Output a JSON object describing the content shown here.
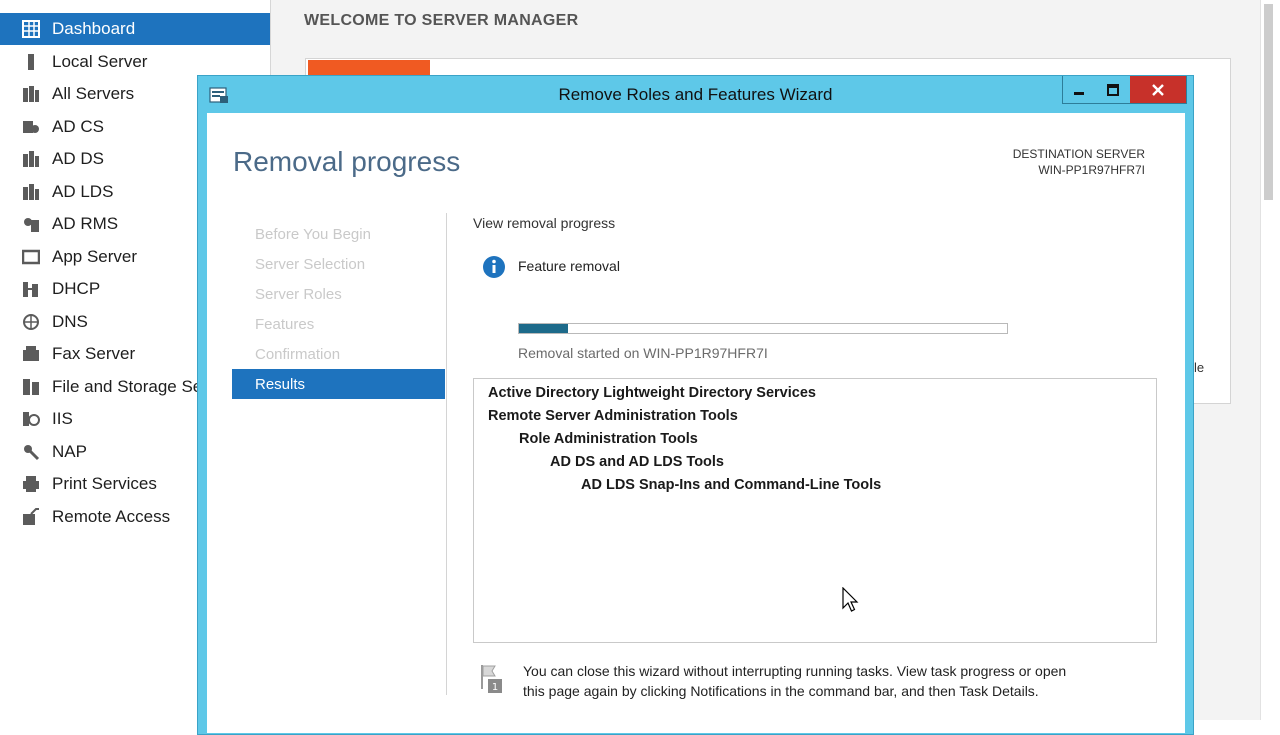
{
  "server_manager": {
    "welcome_title": "WELCOME TO SERVER MANAGER",
    "nav": [
      {
        "label": "Dashboard",
        "icon": "dashboard-icon",
        "active": true
      },
      {
        "label": "Local Server",
        "icon": "server-icon"
      },
      {
        "label": "All Servers",
        "icon": "servers-icon"
      },
      {
        "label": "AD CS",
        "icon": "certificate-icon"
      },
      {
        "label": "AD DS",
        "icon": "directory-icon"
      },
      {
        "label": "AD LDS",
        "icon": "directory-icon"
      },
      {
        "label": "AD RMS",
        "icon": "rights-icon"
      },
      {
        "label": "App Server",
        "icon": "app-server-icon"
      },
      {
        "label": "DHCP",
        "icon": "dhcp-icon"
      },
      {
        "label": "DNS",
        "icon": "dns-icon"
      },
      {
        "label": "Fax Server",
        "icon": "fax-icon"
      },
      {
        "label": "File and Storage Services",
        "icon": "storage-icon"
      },
      {
        "label": "IIS",
        "icon": "iis-icon"
      },
      {
        "label": "NAP",
        "icon": "nap-icon"
      },
      {
        "label": "Print Services",
        "icon": "printer-icon"
      },
      {
        "label": "Remote Access",
        "icon": "remote-access-icon"
      }
    ],
    "peek_text": "le"
  },
  "wizard": {
    "title": "Remove Roles and Features Wizard",
    "heading": "Removal progress",
    "destination_label": "DESTINATION SERVER",
    "destination_server": "WIN-PP1R97HFR7I",
    "steps": [
      {
        "label": "Before You Begin",
        "active": false
      },
      {
        "label": "Server Selection",
        "active": false
      },
      {
        "label": "Server Roles",
        "active": false
      },
      {
        "label": "Features",
        "active": false
      },
      {
        "label": "Confirmation",
        "active": false
      },
      {
        "label": "Results",
        "active": true
      }
    ],
    "view_progress_label": "View removal progress",
    "feature_removal_label": "Feature removal",
    "progress_fraction": 0.1,
    "removal_started": "Removal started on WIN-PP1R97HFR7I",
    "results": [
      {
        "label": "Active Directory Lightweight Directory Services",
        "level": 0
      },
      {
        "label": "Remote Server Administration Tools",
        "level": 0
      },
      {
        "label": "Role Administration Tools",
        "level": 1
      },
      {
        "label": "AD DS and AD LDS Tools",
        "level": 2
      },
      {
        "label": "AD LDS Snap-Ins and Command-Line Tools",
        "level": 3
      }
    ],
    "note": "You can close this wizard without interrupting running tasks. View task progress or open this page again by clicking Notifications in the command bar, and then Task Details."
  },
  "colors": {
    "title_bar": "#5ec8e8",
    "selection_blue": "#1e73be",
    "close_red": "#c7312a",
    "progress_fill": "#1d6a8a",
    "heading_blue": "#4b6a88",
    "accent_orange": "#f05a22"
  }
}
